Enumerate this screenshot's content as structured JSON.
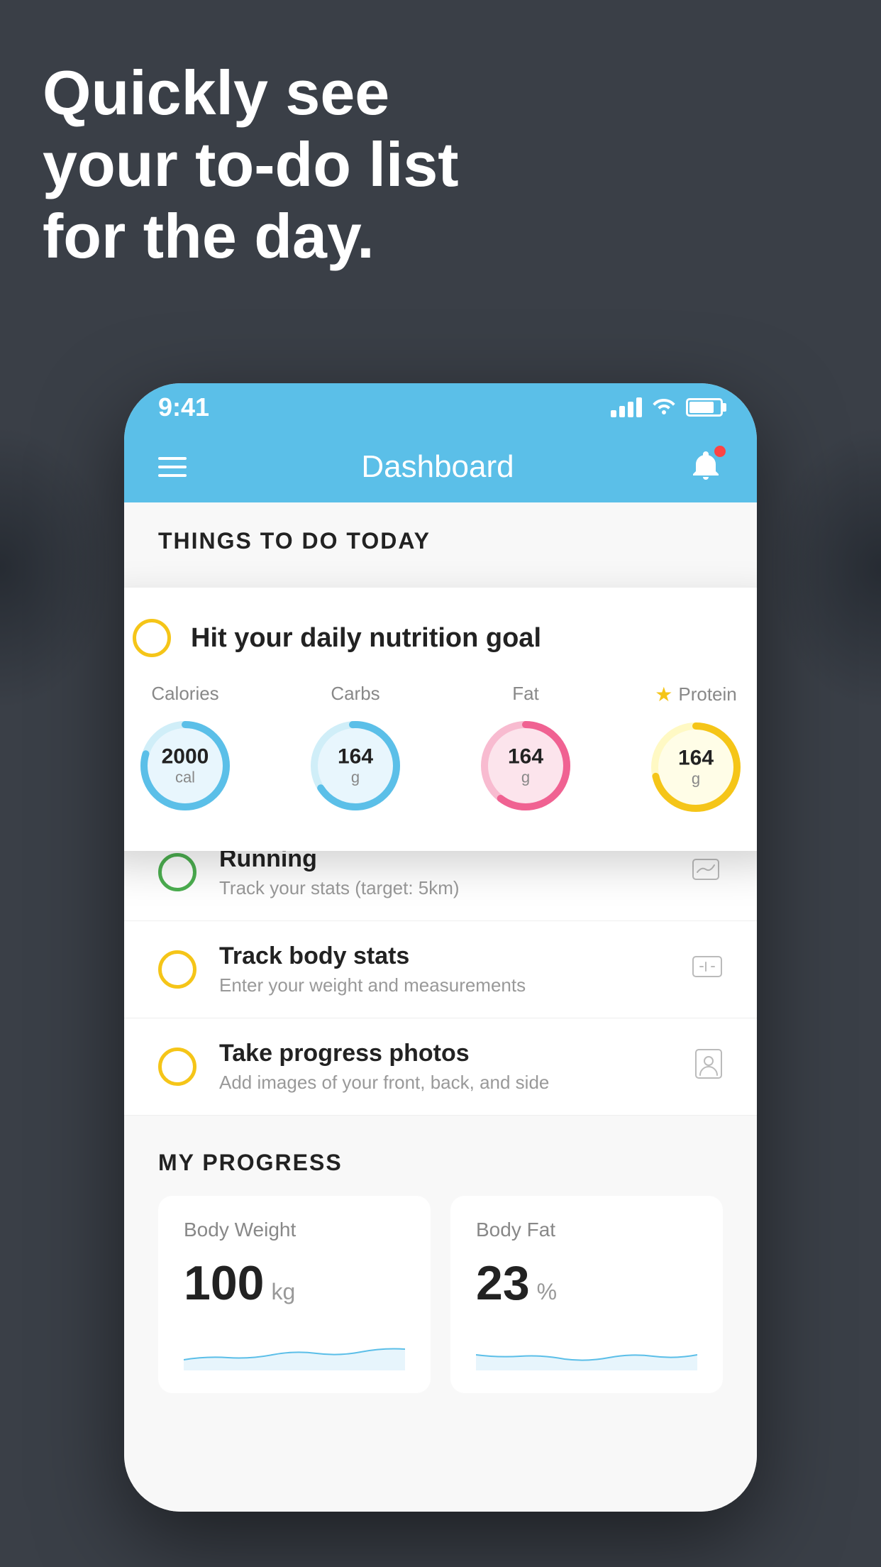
{
  "headline": {
    "line1": "Quickly see",
    "line2": "your to-do list",
    "line3": "for the day."
  },
  "status_bar": {
    "time": "9:41"
  },
  "nav": {
    "title": "Dashboard"
  },
  "things_today": {
    "header": "THINGS TO DO TODAY"
  },
  "nutrition_card": {
    "title": "Hit your daily nutrition goal",
    "items": [
      {
        "label": "Calories",
        "value": "2000",
        "unit": "cal",
        "color": "#5bbfe8",
        "bg": "#e8f6fd"
      },
      {
        "label": "Carbs",
        "value": "164",
        "unit": "g",
        "color": "#5bbfe8",
        "bg": "#e8f6fd"
      },
      {
        "label": "Fat",
        "value": "164",
        "unit": "g",
        "color": "#f06292",
        "bg": "#fce4ec"
      },
      {
        "label": "Protein",
        "value": "164",
        "unit": "g",
        "color": "#f5c518",
        "bg": "#fffde7",
        "star": true
      }
    ]
  },
  "todo_items": [
    {
      "title": "Running",
      "subtitle": "Track your stats (target: 5km)",
      "circle": "green",
      "icon": "shoe"
    },
    {
      "title": "Track body stats",
      "subtitle": "Enter your weight and measurements",
      "circle": "yellow",
      "icon": "scale"
    },
    {
      "title": "Take progress photos",
      "subtitle": "Add images of your front, back, and side",
      "circle": "yellow",
      "icon": "person"
    }
  ],
  "progress": {
    "header": "MY PROGRESS",
    "cards": [
      {
        "title": "Body Weight",
        "value": "100",
        "unit": "kg"
      },
      {
        "title": "Body Fat",
        "value": "23",
        "unit": "%"
      }
    ]
  }
}
